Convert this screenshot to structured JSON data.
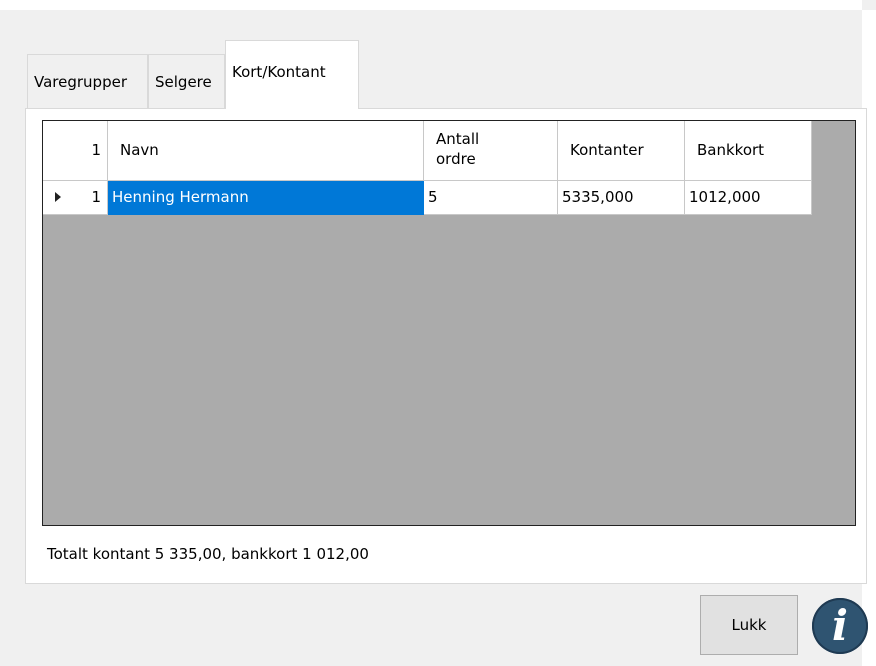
{
  "tabs": [
    {
      "label": "Varegrupper"
    },
    {
      "label": "Selgere"
    },
    {
      "label": "Kort/Kontant"
    }
  ],
  "active_tab": "Kort/Kontant",
  "grid": {
    "row_count_header": "1",
    "columns": [
      {
        "label": "Navn"
      },
      {
        "label": "Antall\nordre"
      },
      {
        "label": "Kontanter"
      },
      {
        "label": "Bankkort"
      }
    ],
    "rows": [
      {
        "index": "1",
        "navn": "Henning Hermann",
        "antall_ordre": "5",
        "kontanter": "5335,000",
        "bankkort": "1012,000",
        "selected": true
      }
    ]
  },
  "summary_text": "Totalt kontant 5 335,00, bankkort 1 012,00",
  "buttons": {
    "close_label": "Lukk"
  },
  "icons": {
    "info": "info-icon"
  },
  "colors": {
    "selection": "#0078d7",
    "grid_background": "#ababab",
    "info_icon": "#2f5471"
  }
}
